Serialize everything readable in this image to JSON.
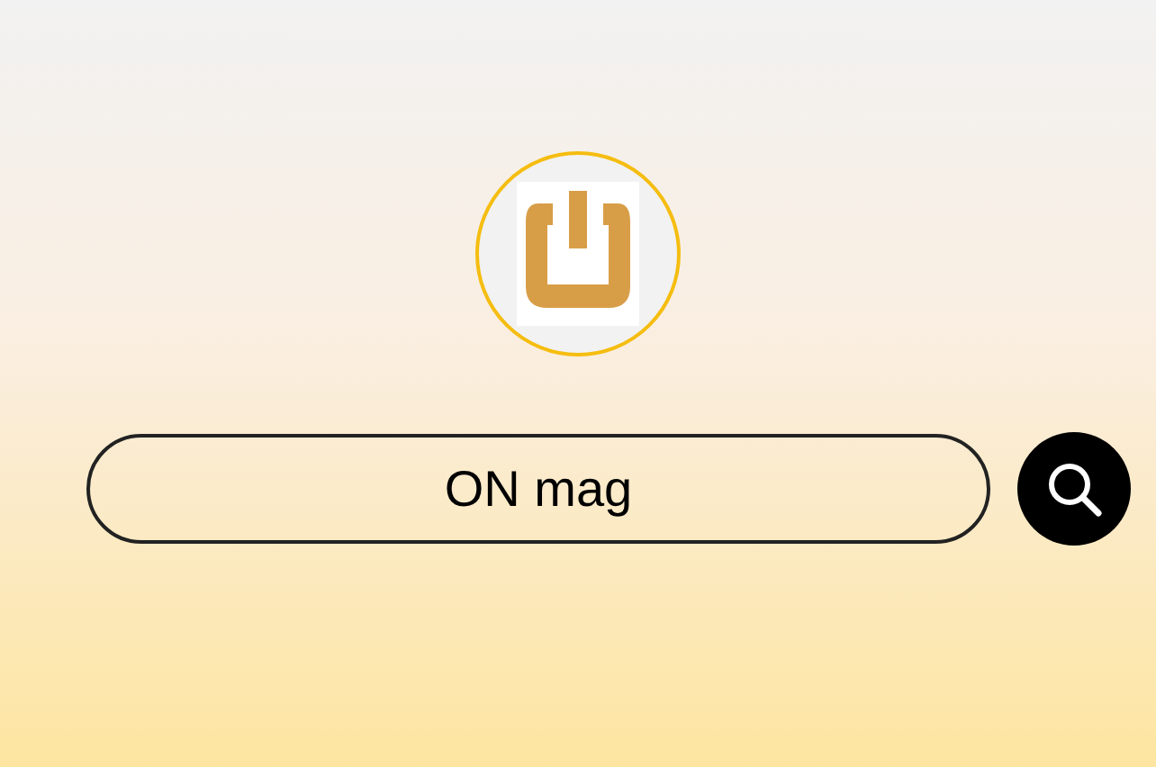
{
  "search": {
    "value": "ON mag"
  }
}
